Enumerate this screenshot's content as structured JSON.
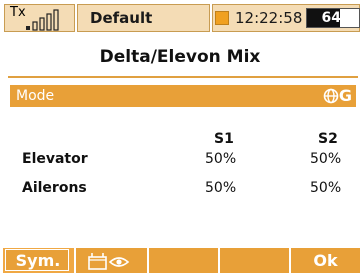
{
  "status_bar": {
    "tx_label": "Tx",
    "model_name": "Default",
    "model_indicator_color": "#f0a020",
    "clock": "12:22:58",
    "battery_percent": 64,
    "battery_text": "64%",
    "signal_icon": "signal-bars-icon"
  },
  "page": {
    "title": "Delta/Elevon Mix"
  },
  "mode": {
    "label": "Mode",
    "icon": "globe-icon",
    "value_letter": "G"
  },
  "table": {
    "columns": [
      "S1",
      "S2"
    ],
    "rows": [
      {
        "label": "Elevator",
        "s1": "50%",
        "s2": "50%"
      },
      {
        "label": "Ailerons",
        "s1": "50%",
        "s2": "50%"
      }
    ]
  },
  "function_keys": {
    "f1_label": "Sym.",
    "f2_icon": "camera-eye-icon",
    "f3_label": "",
    "f4_label": "",
    "f5_label": "Ok"
  },
  "colors": {
    "accent": "#e8a038",
    "status_bg": "#f4dcb5"
  }
}
